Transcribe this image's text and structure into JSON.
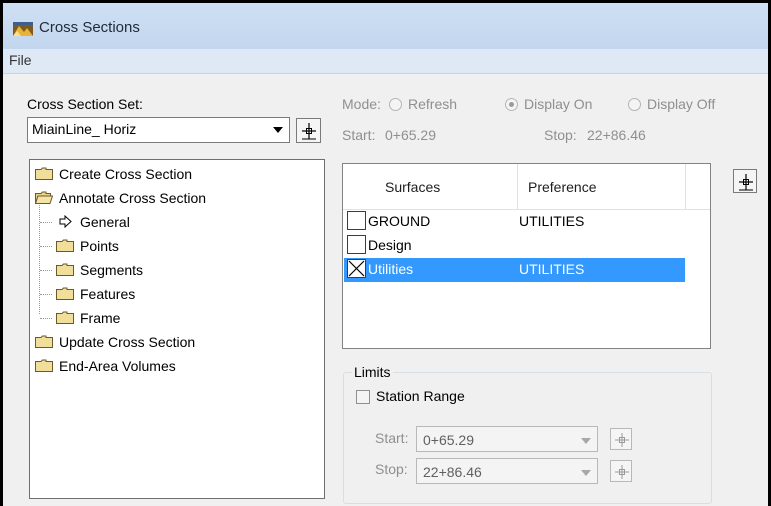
{
  "window": {
    "title": "Cross Sections",
    "app_icon": "cross-section-app-icon"
  },
  "menu": {
    "items": [
      "File"
    ]
  },
  "cross_section_set": {
    "label": "Cross Section Set:",
    "value": "MiainLine_ Horiz",
    "pick_icon": "target-crosshair-icon"
  },
  "mode": {
    "label": "Mode:",
    "options": [
      {
        "label": "Refresh",
        "selected": false
      },
      {
        "label": "Display On",
        "selected": true
      },
      {
        "label": "Display Off",
        "selected": false
      }
    ],
    "start_label": "Start:",
    "start_value": "0+65.29",
    "stop_label": "Stop:",
    "stop_value": "22+86.46"
  },
  "tree": {
    "items": [
      {
        "label": "Create Cross Section",
        "level": 0,
        "icon": "folder-closed-icon"
      },
      {
        "label": "Annotate Cross Section",
        "level": 0,
        "icon": "folder-open-icon"
      },
      {
        "label": "General",
        "level": 1,
        "icon": "arrow-right-icon",
        "selected": true
      },
      {
        "label": "Points",
        "level": 1,
        "icon": "folder-closed-icon"
      },
      {
        "label": "Segments",
        "level": 1,
        "icon": "folder-closed-icon"
      },
      {
        "label": "Features",
        "level": 1,
        "icon": "folder-closed-icon"
      },
      {
        "label": "Frame",
        "level": 1,
        "icon": "folder-closed-icon"
      },
      {
        "label": "Update Cross Section",
        "level": 0,
        "icon": "folder-closed-icon"
      },
      {
        "label": "End-Area Volumes",
        "level": 0,
        "icon": "folder-closed-icon"
      }
    ]
  },
  "surfaces": {
    "columns": [
      "Surfaces",
      "Preference"
    ],
    "rows": [
      {
        "surface": "GROUND",
        "preference": "UTILITIES",
        "checked": false,
        "selected": false
      },
      {
        "surface": "Design",
        "preference": "",
        "checked": false,
        "selected": false
      },
      {
        "surface": "Utilities",
        "preference": "UTILITIES",
        "checked": true,
        "selected": true
      }
    ]
  },
  "limits": {
    "title": "Limits",
    "station_range_label": "Station Range",
    "station_range_checked": false,
    "start_label": "Start:",
    "start_value": "0+65.29",
    "stop_label": "Stop:",
    "stop_value": "22+86.46"
  },
  "colors": {
    "selection": "#3399ff",
    "titlebar": "#c7dbf0",
    "disabled_text": "#8f8f8f"
  }
}
